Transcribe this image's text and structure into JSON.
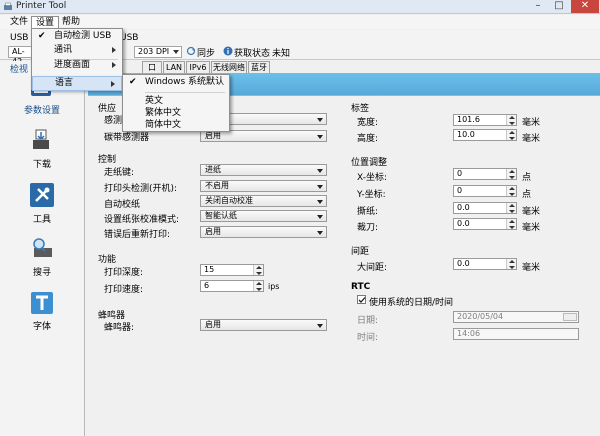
{
  "window": {
    "title": "Printer Tool",
    "min": "–",
    "max": "□",
    "close": "✕"
  },
  "menubar": {
    "file": "文件",
    "settings": "设置",
    "help": "帮助"
  },
  "settings_menu": {
    "auto_detect": "自动检测 USB",
    "comm": "通讯",
    "progress": "进度画面",
    "language": "语言"
  },
  "language_menu": {
    "system_default": "Windows 系统默认",
    "english": "英文",
    "traditional": "繁体中文",
    "simplified": "简体中文"
  },
  "toolbar": {
    "conn_label": "USB",
    "model_value": "AL-42",
    "usb_label": "USB",
    "dpi_value": "203 DPI",
    "sync_label": "同步",
    "status_label": "获取状态",
    "unknown_label": "未知"
  },
  "tabs": [
    "口",
    "LAN",
    "IPv6",
    "无线网络",
    "蓝牙"
  ],
  "sidebar": {
    "view_label": "检视",
    "items": [
      "参数设置",
      "下载",
      "工具",
      "搜寻",
      "字体"
    ]
  },
  "supply": {
    "title": "供应",
    "sensor_label": "感测器",
    "sensor_value": "",
    "carbon_label": "碳带感测器",
    "carbon_value": "启用"
  },
  "control": {
    "title": "控制",
    "feed_key_label": "走纸键:",
    "feed_key_value": "进纸",
    "head_check_label": "打印头检测(开机):",
    "head_check_value": "不启用",
    "auto_calib_label": "自动校纸",
    "auto_calib_value": "关闭自动校准",
    "calib_mode_label": "设置纸张校准模式:",
    "calib_mode_value": "智能认纸",
    "reprint_label": "错误后重新打印:",
    "reprint_value": "启用"
  },
  "function": {
    "title": "功能",
    "darkness_label": "打印深度:",
    "darkness_value": "15",
    "speed_label": "打印速度:",
    "speed_value": "6",
    "speed_unit": "ips"
  },
  "buzzer": {
    "title": "蜂鸣器",
    "label": "蜂鸣器:",
    "value": "启用"
  },
  "label": {
    "title": "标签",
    "width_label": "宽度:",
    "width_value": "101.6",
    "height_label": "高度:",
    "height_value": "10.0",
    "unit": "毫米"
  },
  "position": {
    "title": "位置调整",
    "x_label": "X-坐标:",
    "x_value": "0",
    "y_label": "Y-坐标:",
    "y_value": "0",
    "tear_label": "撕纸:",
    "tear_value": "0.0",
    "cut_label": "裁刀:",
    "cut_value": "0.0",
    "dot_unit": "点",
    "mm_unit": "毫米"
  },
  "gap": {
    "title": "间距",
    "label": "大间距:",
    "value": "0.0",
    "unit": "毫米"
  },
  "rtc": {
    "title": "RTC",
    "use_system_label": "使用系统的日期/时间",
    "date_label": "日期:",
    "date_value": "2020/05/04",
    "time_label": "时间:",
    "time_value": "14:06"
  },
  "colors": {
    "header_band": "#62b6e4",
    "accent_blue": "#3a7ab8",
    "highlight": "#d6e5f5"
  }
}
